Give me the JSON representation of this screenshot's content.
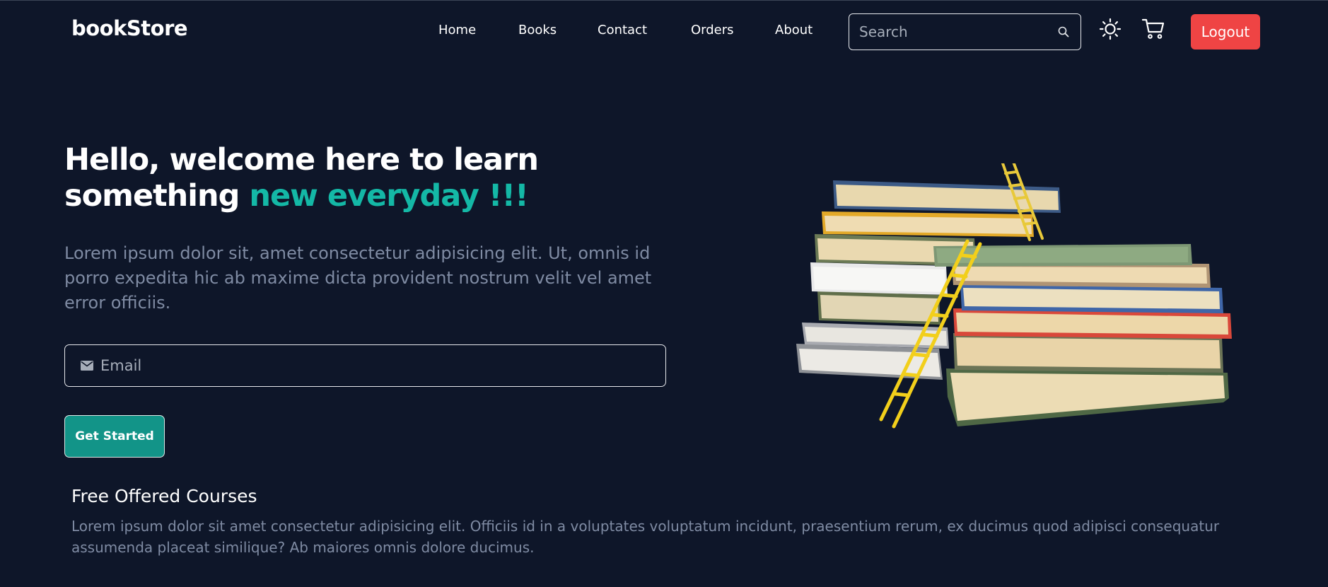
{
  "brand": {
    "logo_text": "bookStore"
  },
  "nav": {
    "items": [
      {
        "label": "Home"
      },
      {
        "label": "Books"
      },
      {
        "label": "Contact"
      },
      {
        "label": "Orders"
      },
      {
        "label": "About"
      }
    ]
  },
  "search": {
    "placeholder": "Search",
    "icon": "search-icon"
  },
  "header_actions": {
    "theme_icon": "sun-icon",
    "cart_icon": "cart-icon",
    "logout_label": "Logout"
  },
  "hero": {
    "title_part1": "Hello, welcome here to learn something ",
    "title_accent": "new everyday !!!",
    "description": "Lorem ipsum dolor sit, amet consectetur adipisicing elit. Ut, omnis id porro expedita hic ab maxime dicta provident nostrum velit vel amet error officiis.",
    "email_placeholder": "Email",
    "email_icon": "mail-icon",
    "cta_label": "Get Started",
    "illustration": "stack-of-books-with-ladder"
  },
  "courses": {
    "title": "Free Offered Courses",
    "description": "Lorem ipsum dolor sit amet consectetur adipisicing elit. Officiis id in a voluptates voluptatum incidunt, praesentium rerum, ex ducimus quod adipisci consequatur assumenda placeat similique? Ab maiores omnis dolore ducimus."
  },
  "colors": {
    "background": "#0e1629",
    "accent": "#14b8a6",
    "button_primary": "#129488",
    "logout": "#ef4444",
    "muted_text": "#7f8ba3"
  }
}
